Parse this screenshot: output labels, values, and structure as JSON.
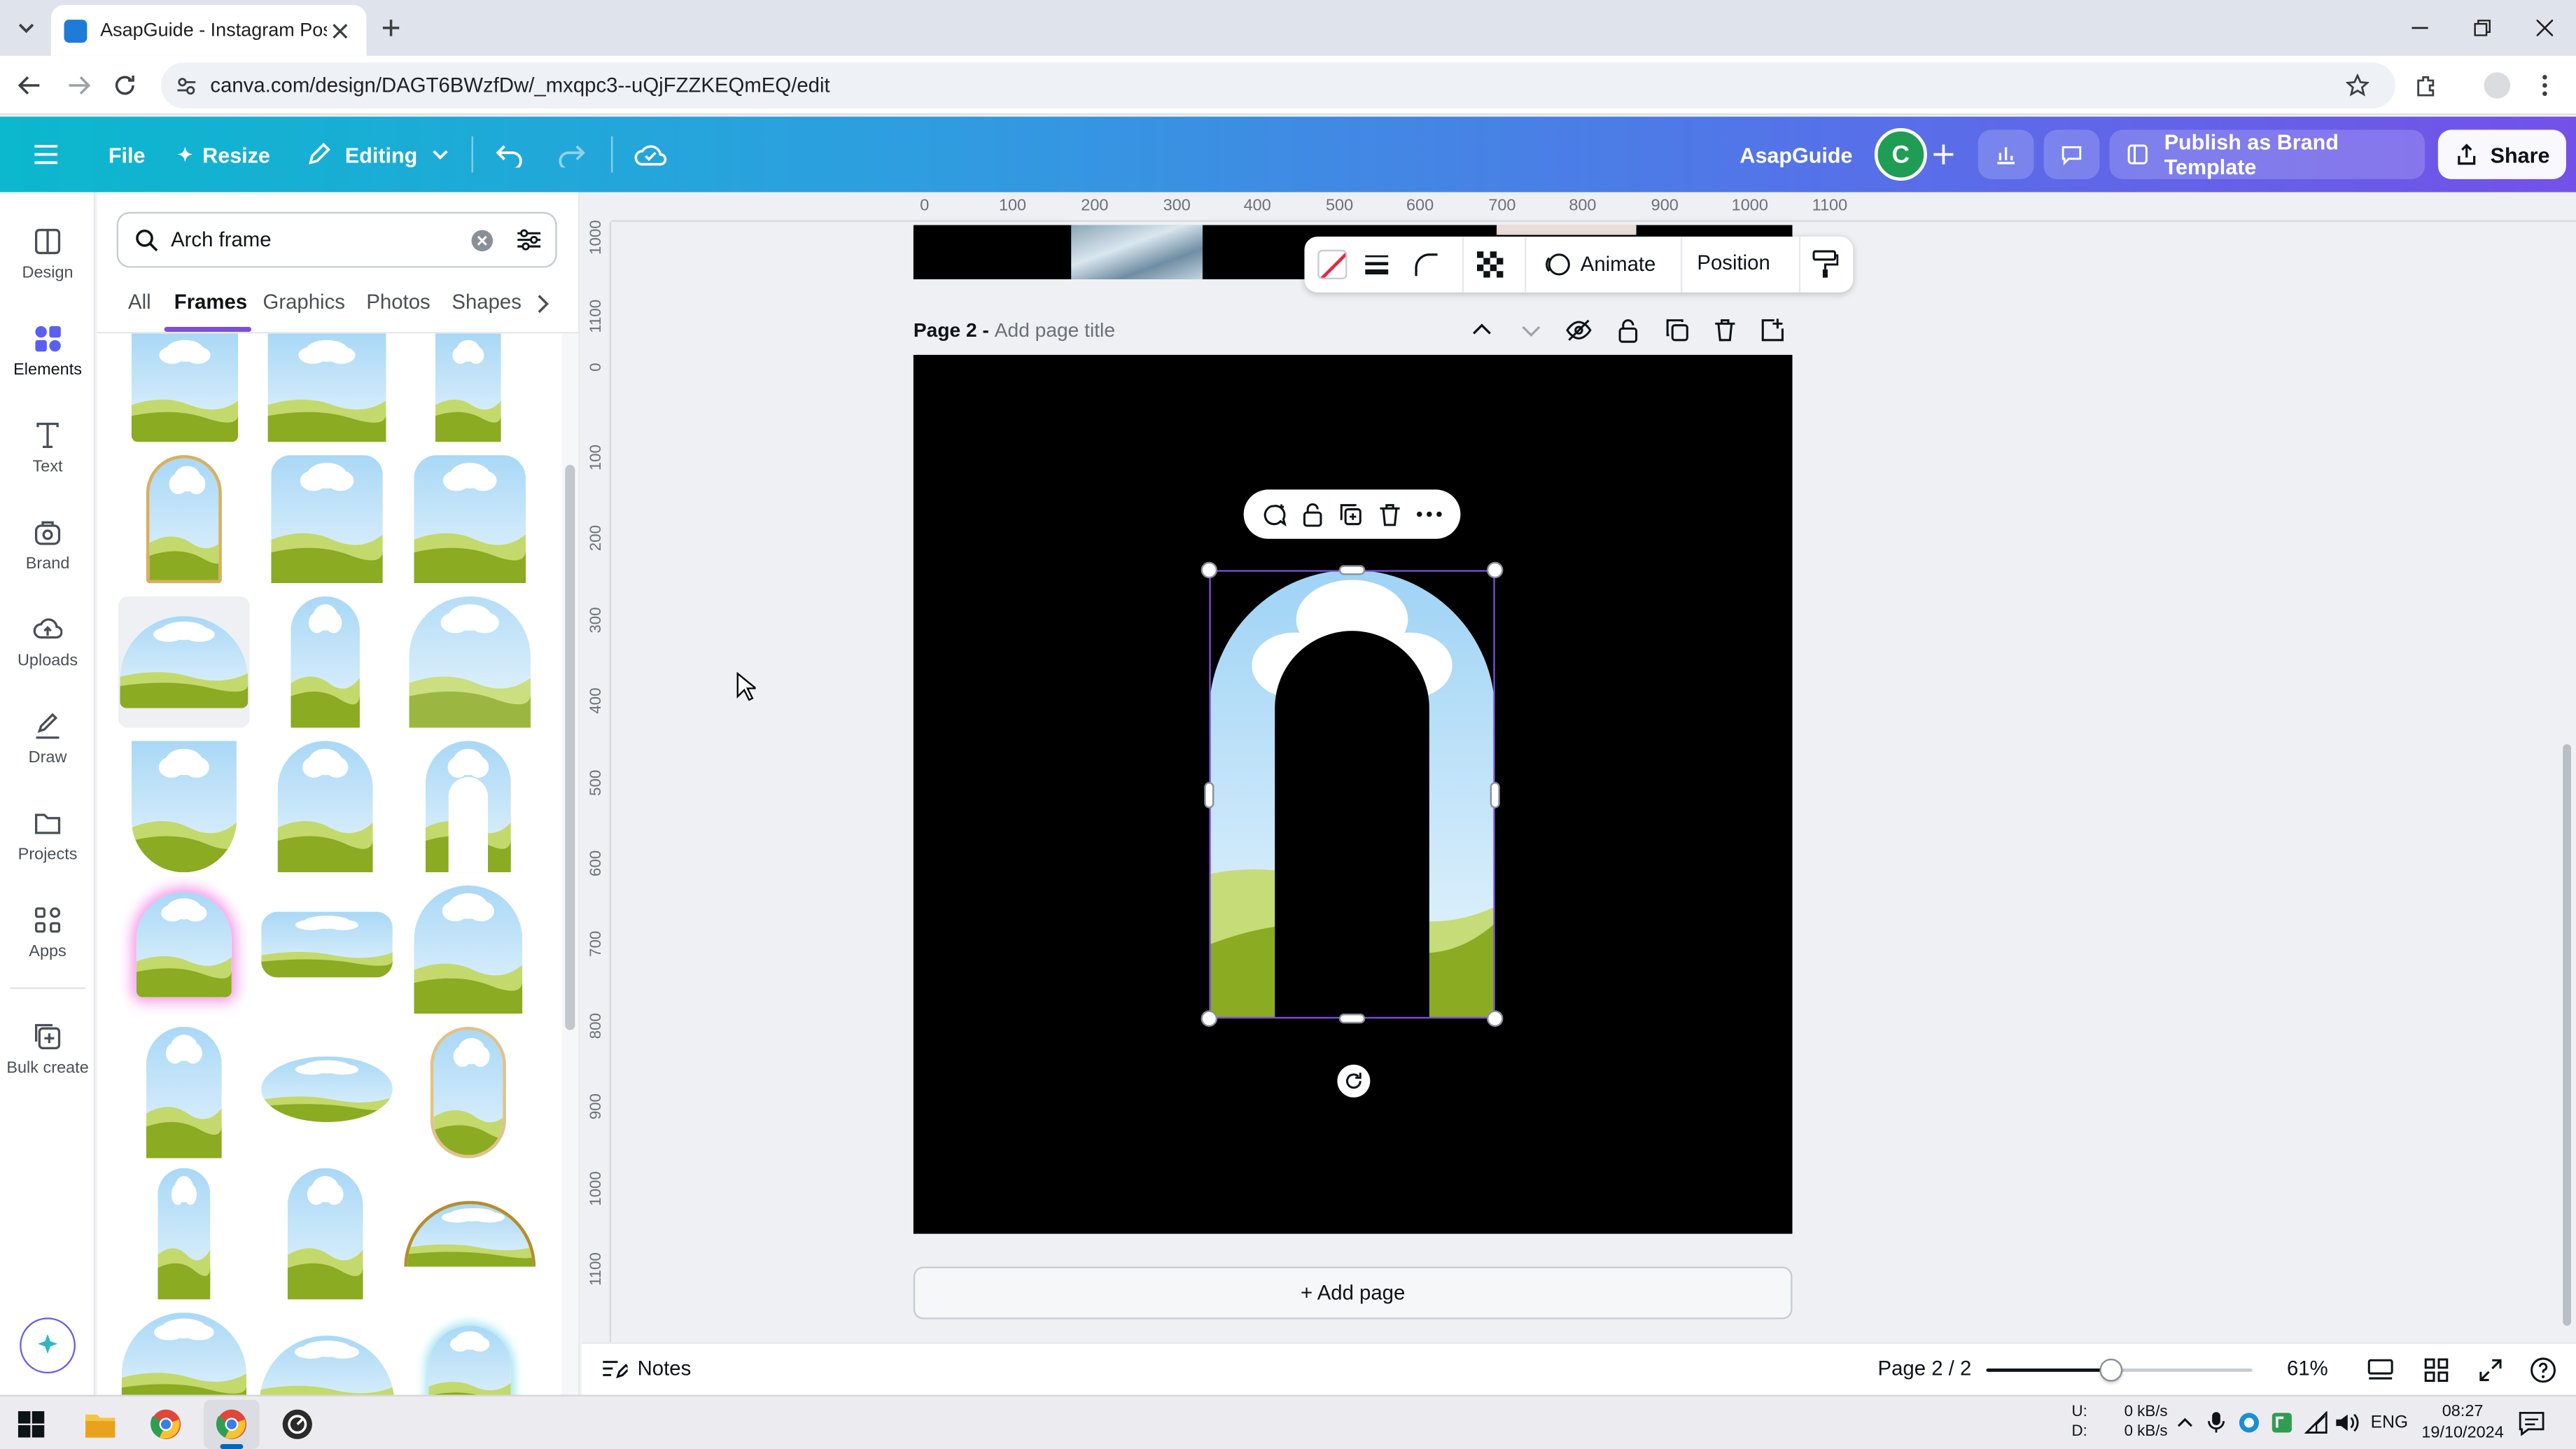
{
  "browser": {
    "tab_title": "AsapGuide - Instagram Post",
    "url": "canva.com/design/DAGT6BWzfDw/_mxqpc3--uQjFZZKEQmEQ/edit"
  },
  "header": {
    "file": "File",
    "resize": "Resize",
    "editing": "Editing",
    "team_name": "AsapGuide",
    "avatar_letter": "C",
    "publish": "Publish as Brand Template",
    "share": "Share"
  },
  "rail": [
    "Design",
    "Elements",
    "Text",
    "Brand",
    "Uploads",
    "Draw",
    "Projects",
    "Apps",
    "Bulk create"
  ],
  "panel": {
    "search_value": "Arch frame",
    "tabs": [
      "All",
      "Frames",
      "Graphics",
      "Photos",
      "Shapes"
    ],
    "active_tab": "Frames"
  },
  "ruler": {
    "horizontal": [
      "0",
      "100",
      "200",
      "300",
      "400",
      "500",
      "600",
      "700",
      "800",
      "900",
      "1000",
      "1100"
    ],
    "vertical": [
      "1000",
      "1100",
      "0",
      "100",
      "200",
      "300",
      "400",
      "500",
      "600",
      "700",
      "800",
      "900",
      "1000",
      "1100"
    ]
  },
  "float_toolbar": {
    "animate": "Animate",
    "position": "Position"
  },
  "page": {
    "label": "Page 2 - ",
    "title_placeholder": "Add page title"
  },
  "add_page": "+ Add page",
  "footer": {
    "notes": "Notes",
    "page_counter": "Page 2 / 2",
    "zoom": "61%",
    "zoom_level": 0.61
  },
  "taskbar": {
    "net_up_label": "U:",
    "net_down_label": "D:",
    "net_up": "0 kB/s",
    "net_down": "0 kB/s",
    "language": "ENG",
    "time": "08:27",
    "date": "19/10/2024"
  },
  "colors": {
    "sky": "#cfe9fb",
    "grass": "#8aab22",
    "grass_light": "#b8d35a",
    "selection": "#7b4fd8",
    "canva_cyan": "#0bb8cd",
    "canva_purple": "#7351e8"
  }
}
